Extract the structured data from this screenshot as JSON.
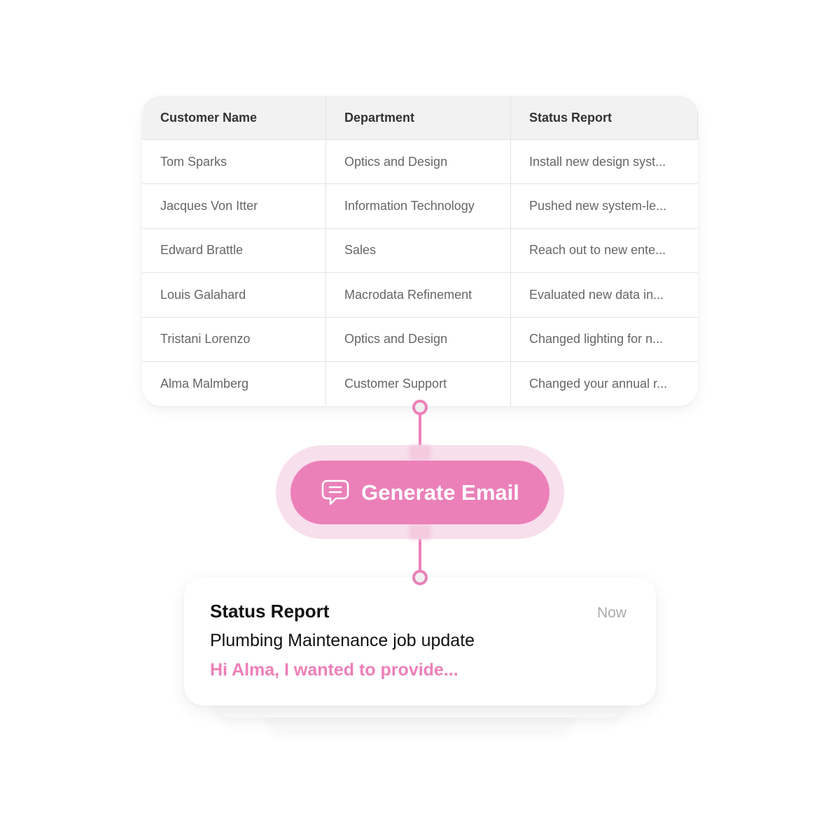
{
  "table": {
    "columns": [
      "Customer Name",
      "Department",
      "Status Report"
    ],
    "rows": [
      [
        "Tom Sparks",
        "Optics and Design",
        "Install new design syst..."
      ],
      [
        "Jacques Von Itter",
        "Information Technology",
        "Pushed new system-le..."
      ],
      [
        "Edward Brattle",
        "Sales",
        "Reach out to new ente..."
      ],
      [
        "Louis Galahard",
        "Macrodata Refinement",
        "Evaluated new data in..."
      ],
      [
        "Tristani Lorenzo",
        "Optics and Design",
        "Changed lighting for n..."
      ],
      [
        "Alma Malmberg",
        "Customer Support",
        "Changed your annual r..."
      ]
    ]
  },
  "action": {
    "label": "Generate Email",
    "icon": "chat-bubble-icon"
  },
  "email": {
    "title": "Status Report",
    "time": "Now",
    "subject": "Plumbing Maintenance job update",
    "preview": "Hi Alma, I wanted to provide..."
  },
  "colors": {
    "accent": "#eb80b9",
    "accent_light": "#f8dfec",
    "header_bg": "#f2f2f2",
    "muted_text": "#aaaaaa"
  }
}
